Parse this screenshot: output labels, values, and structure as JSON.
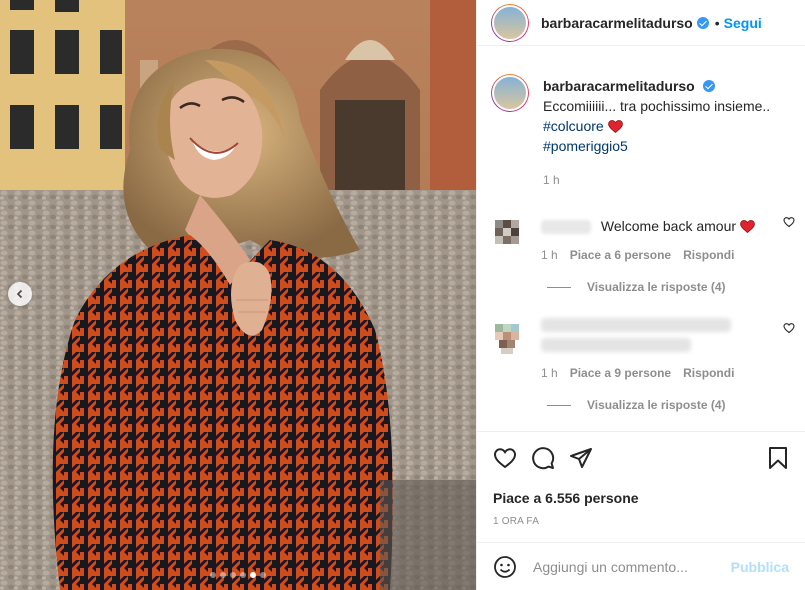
{
  "post": {
    "author": "barbaracarmelitadurso",
    "verified": true,
    "follow_label": "Segui",
    "separator": "•"
  },
  "caption": {
    "username": "barbaracarmelitadurso",
    "text": "Eccomiiiiii... tra pochissimo insieme..",
    "hashtag_1": "#colcuore",
    "hashtag_2": "#pomeriggio5",
    "time": "1 h"
  },
  "comments": [
    {
      "text": "Welcome back amour",
      "time": "1 h",
      "likes": "Piace a 6 persone",
      "reply": "Rispondi",
      "view_replies": "Visualizza le risposte (4)"
    },
    {
      "time": "1 h",
      "likes": "Piace a 9 persone",
      "reply": "Rispondi",
      "view_replies": "Visualizza le risposte (4)"
    }
  ],
  "footer": {
    "likes": "Piace a 6.556 persone",
    "posted": "1 ORA FA",
    "comment_placeholder": "Aggiungi un commento...",
    "publish_label": "Pubblica"
  },
  "carousel": {
    "slide_count": 6,
    "active_slide": 5
  },
  "icons": [
    "heart-icon",
    "comment-icon",
    "share-icon",
    "bookmark-icon",
    "emoji-icon",
    "chevron-left-icon",
    "verified-icon"
  ],
  "colors": {
    "link": "#0095f6",
    "hashtag": "#00376b",
    "muted": "#8e8e8e",
    "publish_disabled": "#b2dffc",
    "heart": "#ed4956"
  }
}
